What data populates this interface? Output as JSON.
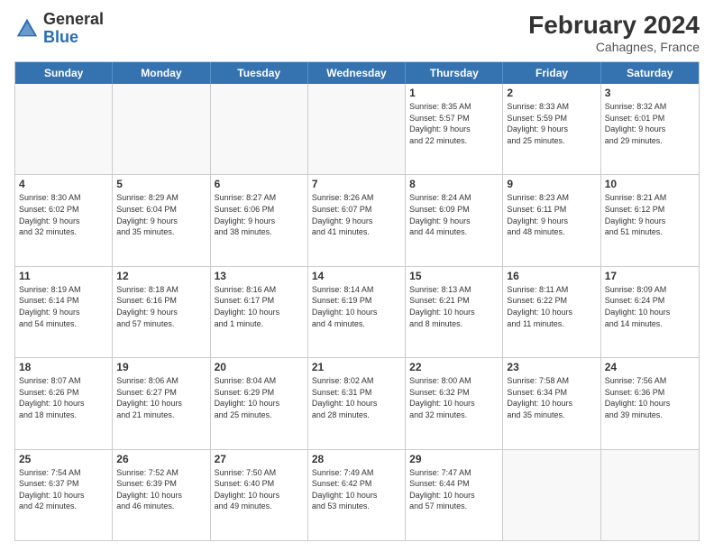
{
  "header": {
    "logo_general": "General",
    "logo_blue": "Blue",
    "month_year": "February 2024",
    "location": "Cahagnes, France"
  },
  "weekdays": [
    "Sunday",
    "Monday",
    "Tuesday",
    "Wednesday",
    "Thursday",
    "Friday",
    "Saturday"
  ],
  "rows": [
    [
      {
        "day": "",
        "info": "",
        "empty": true
      },
      {
        "day": "",
        "info": "",
        "empty": true
      },
      {
        "day": "",
        "info": "",
        "empty": true
      },
      {
        "day": "",
        "info": "",
        "empty": true
      },
      {
        "day": "1",
        "info": "Sunrise: 8:35 AM\nSunset: 5:57 PM\nDaylight: 9 hours\nand 22 minutes."
      },
      {
        "day": "2",
        "info": "Sunrise: 8:33 AM\nSunset: 5:59 PM\nDaylight: 9 hours\nand 25 minutes."
      },
      {
        "day": "3",
        "info": "Sunrise: 8:32 AM\nSunset: 6:01 PM\nDaylight: 9 hours\nand 29 minutes."
      }
    ],
    [
      {
        "day": "4",
        "info": "Sunrise: 8:30 AM\nSunset: 6:02 PM\nDaylight: 9 hours\nand 32 minutes."
      },
      {
        "day": "5",
        "info": "Sunrise: 8:29 AM\nSunset: 6:04 PM\nDaylight: 9 hours\nand 35 minutes."
      },
      {
        "day": "6",
        "info": "Sunrise: 8:27 AM\nSunset: 6:06 PM\nDaylight: 9 hours\nand 38 minutes."
      },
      {
        "day": "7",
        "info": "Sunrise: 8:26 AM\nSunset: 6:07 PM\nDaylight: 9 hours\nand 41 minutes."
      },
      {
        "day": "8",
        "info": "Sunrise: 8:24 AM\nSunset: 6:09 PM\nDaylight: 9 hours\nand 44 minutes."
      },
      {
        "day": "9",
        "info": "Sunrise: 8:23 AM\nSunset: 6:11 PM\nDaylight: 9 hours\nand 48 minutes."
      },
      {
        "day": "10",
        "info": "Sunrise: 8:21 AM\nSunset: 6:12 PM\nDaylight: 9 hours\nand 51 minutes."
      }
    ],
    [
      {
        "day": "11",
        "info": "Sunrise: 8:19 AM\nSunset: 6:14 PM\nDaylight: 9 hours\nand 54 minutes."
      },
      {
        "day": "12",
        "info": "Sunrise: 8:18 AM\nSunset: 6:16 PM\nDaylight: 9 hours\nand 57 minutes."
      },
      {
        "day": "13",
        "info": "Sunrise: 8:16 AM\nSunset: 6:17 PM\nDaylight: 10 hours\nand 1 minute."
      },
      {
        "day": "14",
        "info": "Sunrise: 8:14 AM\nSunset: 6:19 PM\nDaylight: 10 hours\nand 4 minutes."
      },
      {
        "day": "15",
        "info": "Sunrise: 8:13 AM\nSunset: 6:21 PM\nDaylight: 10 hours\nand 8 minutes."
      },
      {
        "day": "16",
        "info": "Sunrise: 8:11 AM\nSunset: 6:22 PM\nDaylight: 10 hours\nand 11 minutes."
      },
      {
        "day": "17",
        "info": "Sunrise: 8:09 AM\nSunset: 6:24 PM\nDaylight: 10 hours\nand 14 minutes."
      }
    ],
    [
      {
        "day": "18",
        "info": "Sunrise: 8:07 AM\nSunset: 6:26 PM\nDaylight: 10 hours\nand 18 minutes."
      },
      {
        "day": "19",
        "info": "Sunrise: 8:06 AM\nSunset: 6:27 PM\nDaylight: 10 hours\nand 21 minutes."
      },
      {
        "day": "20",
        "info": "Sunrise: 8:04 AM\nSunset: 6:29 PM\nDaylight: 10 hours\nand 25 minutes."
      },
      {
        "day": "21",
        "info": "Sunrise: 8:02 AM\nSunset: 6:31 PM\nDaylight: 10 hours\nand 28 minutes."
      },
      {
        "day": "22",
        "info": "Sunrise: 8:00 AM\nSunset: 6:32 PM\nDaylight: 10 hours\nand 32 minutes."
      },
      {
        "day": "23",
        "info": "Sunrise: 7:58 AM\nSunset: 6:34 PM\nDaylight: 10 hours\nand 35 minutes."
      },
      {
        "day": "24",
        "info": "Sunrise: 7:56 AM\nSunset: 6:36 PM\nDaylight: 10 hours\nand 39 minutes."
      }
    ],
    [
      {
        "day": "25",
        "info": "Sunrise: 7:54 AM\nSunset: 6:37 PM\nDaylight: 10 hours\nand 42 minutes."
      },
      {
        "day": "26",
        "info": "Sunrise: 7:52 AM\nSunset: 6:39 PM\nDaylight: 10 hours\nand 46 minutes."
      },
      {
        "day": "27",
        "info": "Sunrise: 7:50 AM\nSunset: 6:40 PM\nDaylight: 10 hours\nand 49 minutes."
      },
      {
        "day": "28",
        "info": "Sunrise: 7:49 AM\nSunset: 6:42 PM\nDaylight: 10 hours\nand 53 minutes."
      },
      {
        "day": "29",
        "info": "Sunrise: 7:47 AM\nSunset: 6:44 PM\nDaylight: 10 hours\nand 57 minutes."
      },
      {
        "day": "",
        "info": "",
        "empty": true
      },
      {
        "day": "",
        "info": "",
        "empty": true
      }
    ]
  ]
}
